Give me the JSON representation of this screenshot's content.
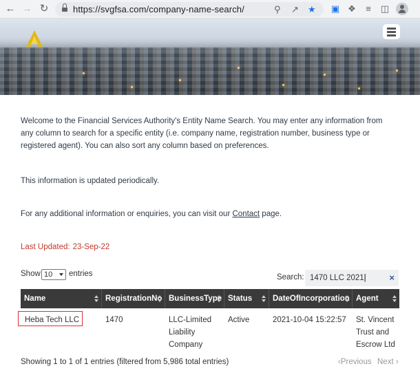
{
  "browser": {
    "url": "https://svgfsa.com/company-name-search/"
  },
  "intro": {
    "welcome": "Welcome to the Financial Services Authority's Entity Name Search. You may enter any information from any column to search for a specific entity (i.e. company name, registration number, business type or registered agent). You can also sort any column based on preferences.",
    "periodic": "This information is updated periodically.",
    "contact_before": "For any additional information or enquiries, you can visit our ",
    "contact_link": "Contact",
    "contact_after": " page."
  },
  "last_updated": {
    "label": "Last Updated:",
    "date": "23-Sep-22"
  },
  "controls": {
    "show_label": "Show",
    "page_size": "10",
    "entries_label": "entries",
    "search_label": "Search:",
    "search_value": "1470 LLC 2021"
  },
  "table": {
    "headers": [
      "Name",
      "RegistrationNo",
      "BusinessType",
      "Status",
      "DateOfIncorporation",
      "Agent"
    ],
    "rows": [
      {
        "name": "Heba Tech LLC",
        "registration_no": "1470",
        "business_type": [
          "LLC-Limited",
          "Liability",
          "Company"
        ],
        "status": "Active",
        "date": "2021-10-04 15:22:57",
        "agent": [
          "St. Vincent",
          "Trust and",
          "Escrow Ltd"
        ]
      }
    ]
  },
  "footer": {
    "info": "Showing 1 to 1 of 1 entries (filtered from 5,986 total entries)",
    "previous": "Previous",
    "next": "Next"
  },
  "colors": {
    "header_bg": "#3a3a3a",
    "last_updated": "#c0392b",
    "highlight_box": "#d63031",
    "clear_icon": "#2e5a9c"
  }
}
